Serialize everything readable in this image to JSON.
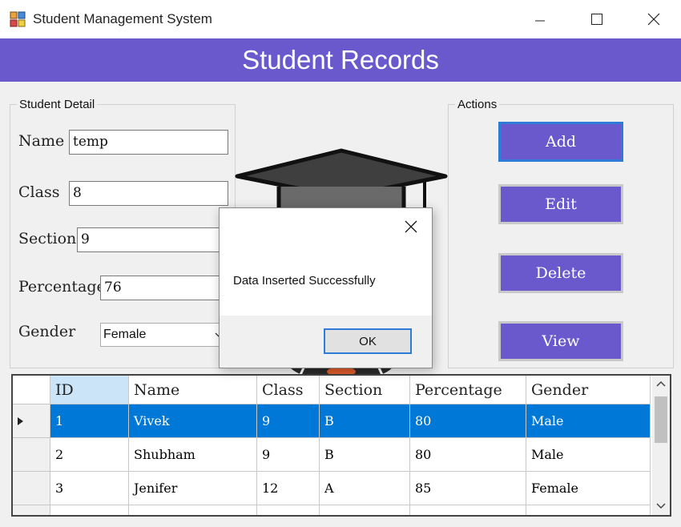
{
  "window": {
    "title": "Student Management System",
    "controls": [
      "minimize-icon",
      "maximize-icon",
      "close-icon"
    ]
  },
  "header": {
    "title": "Student Records"
  },
  "student_detail": {
    "legend": "Student Detail",
    "name_label": "Name",
    "name_value": "temp",
    "class_label": "Class",
    "class_value": "8",
    "section_label": "Section",
    "section_value": "9",
    "percentage_label": "Percentage",
    "percentage_value": "76",
    "gender_label": "Gender",
    "gender_value": "Female"
  },
  "actions": {
    "legend": "Actions",
    "add": "Add",
    "edit": "Edit",
    "delete": "Delete",
    "view": "View"
  },
  "grid": {
    "columns": [
      "ID",
      "Name",
      "Class",
      "Section",
      "Percentage",
      "Gender"
    ],
    "rows": [
      [
        "1",
        "Vivek",
        "9",
        "B",
        "80",
        "Male"
      ],
      [
        "2",
        "Shubham",
        "9",
        "B",
        "80",
        "Male"
      ],
      [
        "3",
        "Jenifer",
        "12",
        "A",
        "85",
        "Female"
      ]
    ],
    "selected_row": 0
  },
  "dialog": {
    "message": "Data Inserted Successfully",
    "ok": "OK"
  },
  "colors": {
    "accent": "#6a59cd",
    "selection": "#0078d7",
    "focus_border": "#2f7bd8"
  }
}
